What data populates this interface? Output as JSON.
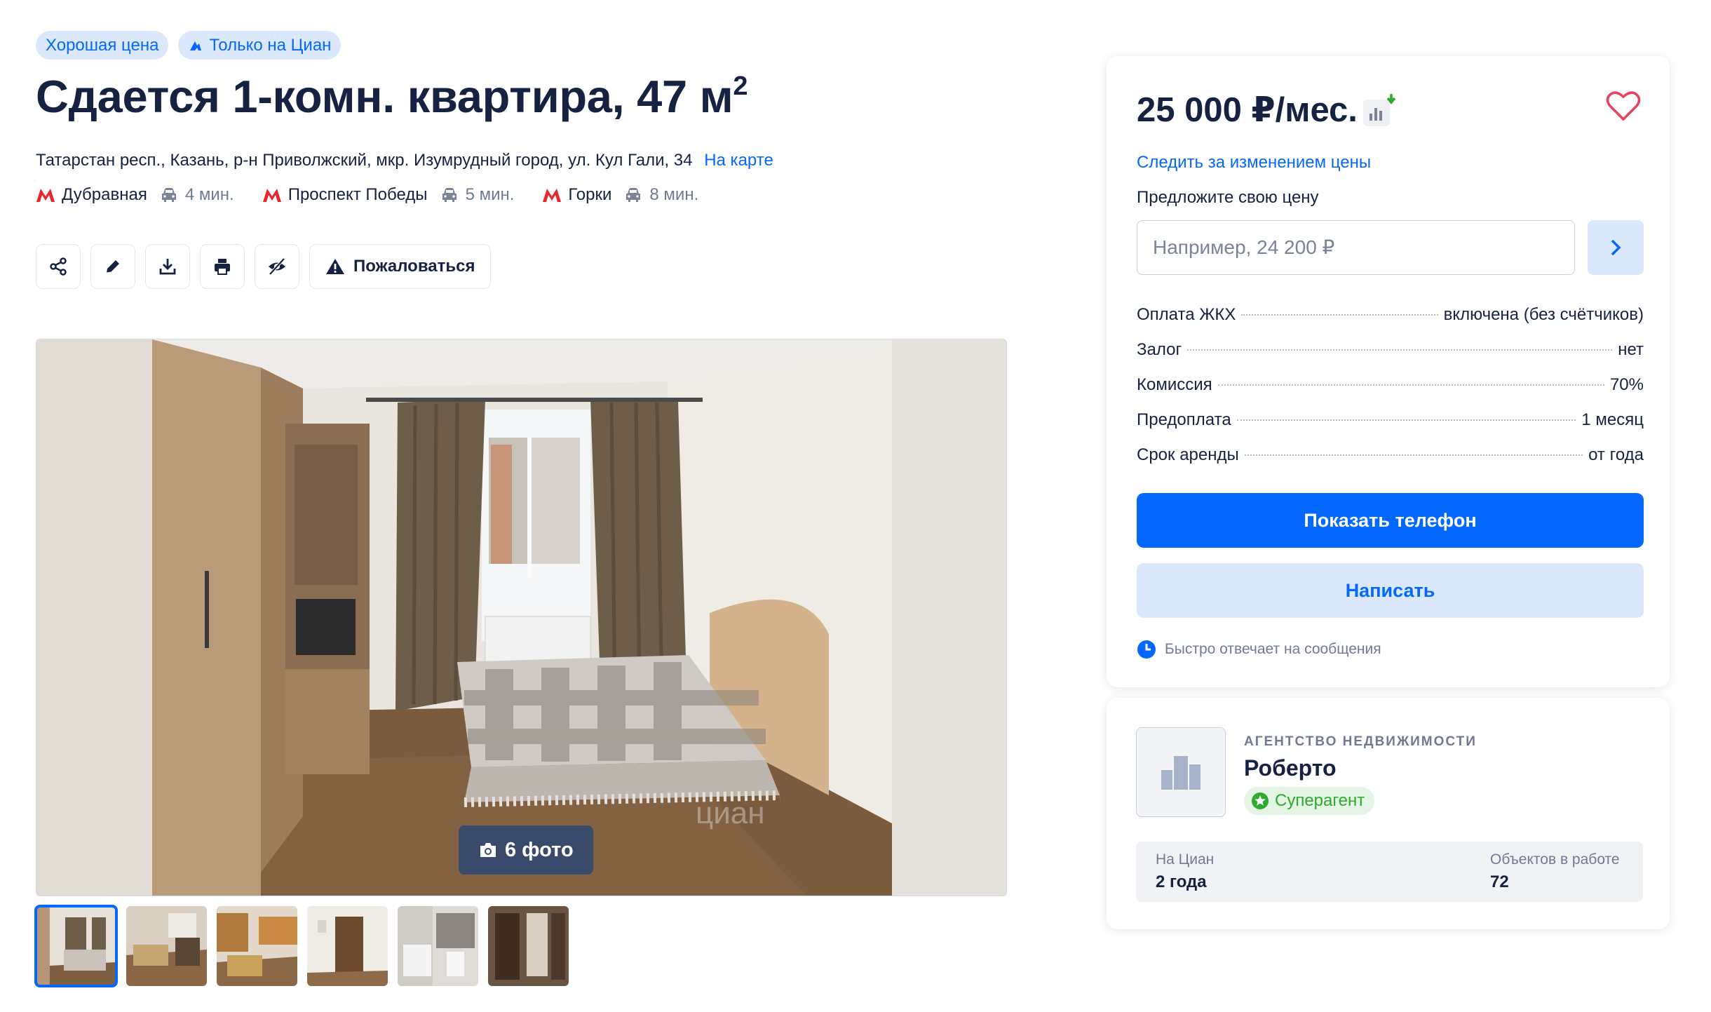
{
  "badges": {
    "good_price": "Хорошая цена",
    "only_cian": "Только на Циан"
  },
  "listing": {
    "title_main": "Сдается 1-комн. квартира, 47 м",
    "title_sup": "2",
    "address": "Татарстан респ., Казань, р-н Приволжский, мкр. Изумрудный город, ул. Кул Гали, 34",
    "map_link": "На карте"
  },
  "metro": [
    {
      "station": "Дубравная",
      "time": "4 мин."
    },
    {
      "station": "Проспект Победы",
      "time": "5 мин."
    },
    {
      "station": "Горки",
      "time": "8 мин."
    }
  ],
  "actions": {
    "complain_label": "Пожаловаться"
  },
  "gallery": {
    "photo_count_label": "6 фото",
    "thumbnail_count": 6,
    "active_thumbnail": 0
  },
  "price_card": {
    "price": "25 000 ₽/мес.",
    "follow_price_link": "Следить за изменением цены",
    "offer_label": "Предложите свою цену",
    "offer_placeholder": "Например, 24 200 ₽",
    "terms": [
      {
        "key": "Оплата ЖКХ",
        "value": "включена (без счётчиков)"
      },
      {
        "key": "Залог",
        "value": "нет"
      },
      {
        "key": "Комиссия",
        "value": "70%"
      },
      {
        "key": "Предоплата",
        "value": "1 месяц"
      },
      {
        "key": "Срок аренды",
        "value": "от года"
      }
    ],
    "show_phone_label": "Показать телефон",
    "write_label": "Написать",
    "response_note": "Быстро отвечает на сообщения"
  },
  "agent": {
    "type": "АГЕНТСТВО НЕДВИЖИМОСТИ",
    "name": "Роберто",
    "badge": "Суперагент",
    "stats": [
      {
        "key": "На Циан",
        "value": "2 года"
      },
      {
        "key": "Объектов в работе",
        "value": "72"
      }
    ]
  },
  "colors": {
    "accent": "#0468ff",
    "accent_light": "#dbe8fb",
    "text_primary": "#152242",
    "text_secondary": "#707a95",
    "metro_red": "#e8262b",
    "favorite_red": "#e84260",
    "success_green": "#2fa92e"
  },
  "icons": {
    "badge_cian": "cian-logo-icon",
    "metro": "metro-m-icon",
    "travel": "car-icon",
    "share": "share-icon",
    "edit": "pencil-icon",
    "download": "download-icon",
    "print": "printer-icon",
    "hide": "eye-crossed-icon",
    "complain": "warning-triangle-icon",
    "camera": "camera-icon",
    "price_chart": "price-chart-icon",
    "favorite": "heart-icon",
    "submit": "chevron-right-icon",
    "clock": "clock-icon",
    "agency": "buildings-icon",
    "superagent": "star-badge-icon"
  }
}
